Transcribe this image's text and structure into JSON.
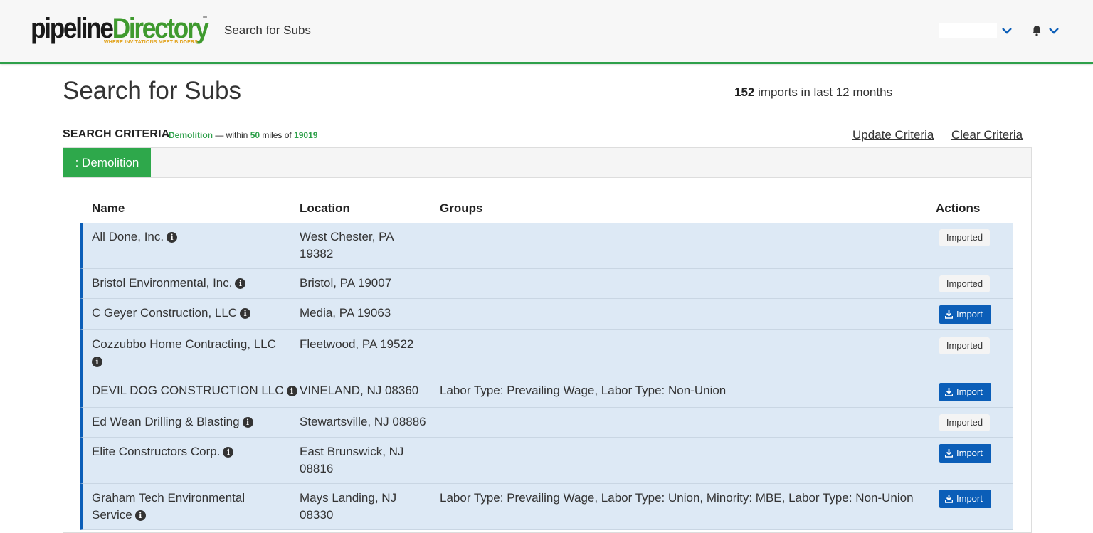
{
  "header": {
    "logo_text_part1": "pipeline",
    "logo_text_part2": "Directory",
    "logo_tagline": "WHERE INVITATIONS MEET BIDDERS",
    "logo_tm": "™",
    "page_link": "Search for Subs",
    "icons": [
      "chevron-down-icon",
      "bell-icon",
      "chevron-down-icon"
    ]
  },
  "page": {
    "title": "Search for Subs",
    "imports_count": "152",
    "imports_text": " imports in last 12 months"
  },
  "criteria": {
    "label": "SEARCH CRITERIA",
    "trade": "Demolition",
    "within_text": " — within ",
    "miles": "50",
    "miles_of_text": " miles of ",
    "zip": "19019",
    "update_label": "Update Criteria",
    "clear_label": "Clear Criteria"
  },
  "tabs": [
    {
      "label": ": Demolition",
      "active": true
    }
  ],
  "table": {
    "columns": [
      "Name",
      "Location",
      "Groups",
      "Actions"
    ],
    "rows": [
      {
        "name": "All Done, Inc.",
        "location": "West Chester, PA 19382",
        "groups": "",
        "action": "Imported"
      },
      {
        "name": "Bristol Environmental, Inc.",
        "location": "Bristol, PA 19007",
        "groups": "",
        "action": "Imported"
      },
      {
        "name": "C Geyer Construction, LLC",
        "location": "Media, PA 19063",
        "groups": "",
        "action": "Import"
      },
      {
        "name": "Cozzubbo Home Contracting, LLC",
        "location": "Fleetwood, PA 19522",
        "groups": "",
        "action": "Imported"
      },
      {
        "name": "DEVIL DOG CONSTRUCTION LLC",
        "location": "VINELAND, NJ 08360",
        "groups": "Labor Type: Prevailing Wage, Labor Type: Non-Union",
        "action": "Import"
      },
      {
        "name": "Ed Wean Drilling & Blasting",
        "location": "Stewartsville, NJ 08886",
        "groups": "",
        "action": "Imported"
      },
      {
        "name": "Elite Constructors Corp.",
        "location": "East Brunswick, NJ 08816",
        "groups": "",
        "action": "Import"
      },
      {
        "name": "Graham Tech Environmental Service",
        "location": "Mays Landing, NJ 08330",
        "groups": "Labor Type: Prevailing Wage, Labor Type: Union, Minority: MBE, Labor Type: Non-Union",
        "action": "Import"
      }
    ]
  },
  "colors": {
    "accent_green": "#2ea84b",
    "primary_blue": "#0b5eb8",
    "row_bg": "#dde9f5"
  }
}
